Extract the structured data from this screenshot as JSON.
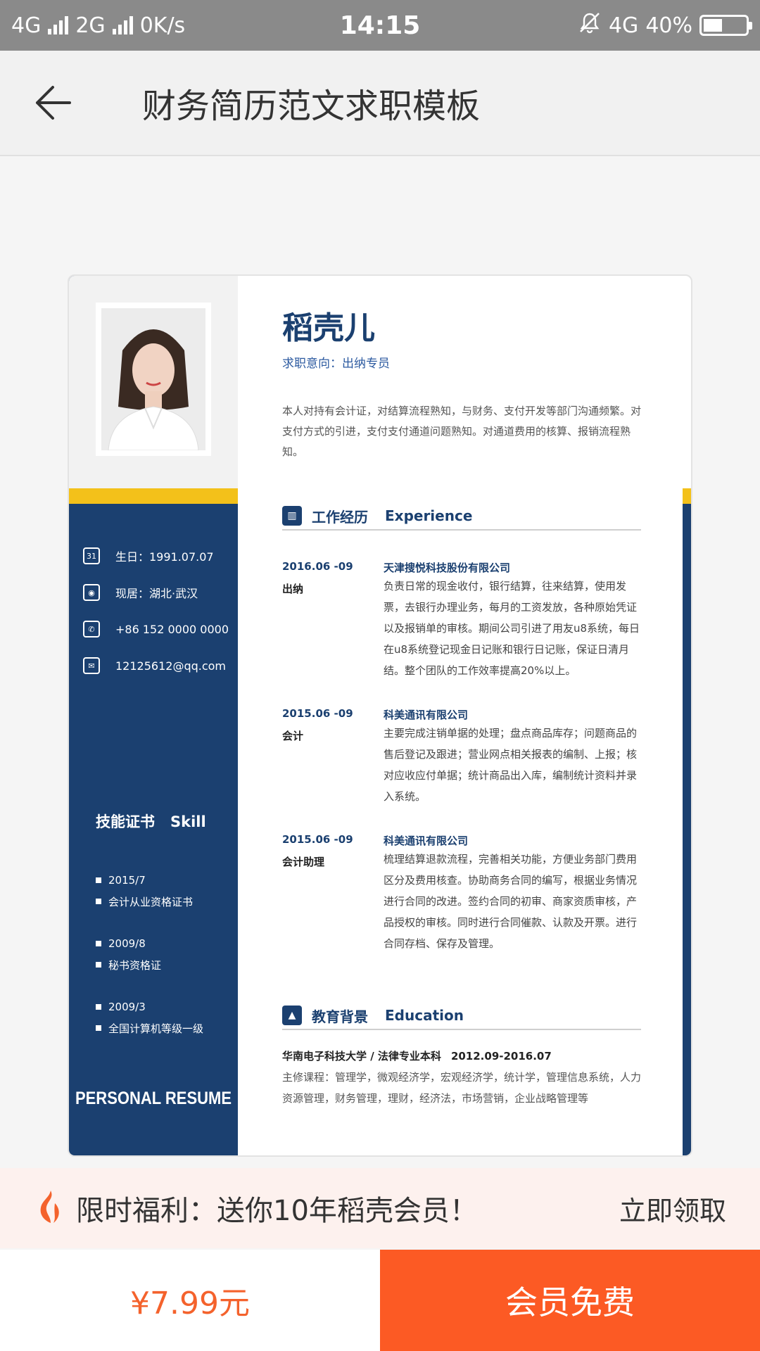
{
  "status_bar": {
    "net1": "4G",
    "net2": "2G",
    "speed": "0K/s",
    "time": "14:15",
    "net3": "4G",
    "battery": "40%"
  },
  "header": {
    "title": "财务简历范文求职模板"
  },
  "resume": {
    "name": "稻壳儿",
    "intent": "求职意向：出纳专员",
    "summary": "本人对持有会计证，对结算流程熟知，与财务、支付开发等部门沟通频繁。对支付方式的引进，支付支付通道问题熟知。对通道费用的核算、报销流程熟知。",
    "contact": [
      {
        "icon": "calendar-icon",
        "text": "生日：1991.07.07"
      },
      {
        "icon": "location-icon",
        "text": "现居：湖北·武汉"
      },
      {
        "icon": "phone-icon",
        "text": "+86 152 0000 0000"
      },
      {
        "icon": "mail-icon",
        "text": "12125612@qq.com"
      }
    ],
    "skill_title_cn": "技能证书",
    "skill_title_en": "Skill",
    "skills": [
      {
        "date": "2015/7",
        "name": "会计从业资格证书"
      },
      {
        "date": "2009/8",
        "name": "秘书资格证"
      },
      {
        "date": "2009/3",
        "name": "全国计算机等级一级"
      }
    ],
    "personal_resume": "PERSONAL RESUME",
    "experience_cn": "工作经历",
    "experience_en": "Experience",
    "jobs": [
      {
        "date": "2016.06 -09",
        "role": "出纳",
        "company": "天津搜悦科技股份有限公司",
        "desc": "负责日常的现金收付，银行结算，往来结算，使用发票，去银行办理业务，每月的工资发放，各种原始凭证以及报销单的审核。期间公司引进了用友u8系统，每日在u8系统登记现金日记账和银行日记账，保证日清月结。整个团队的工作效率提高20%以上。"
      },
      {
        "date": "2015.06 -09",
        "role": "会计",
        "company": "科美通讯有限公司",
        "desc": "主要完成注销单据的处理；盘点商品库存；问题商品的售后登记及跟进；营业网点相关报表的编制、上报；核对应收应付单据；统计商品出入库，编制统计资料并录入系统。"
      },
      {
        "date": "2015.06 -09",
        "role": "会计助理",
        "company": "科美通讯有限公司",
        "desc": "梳理结算退款流程，完善相关功能，方便业务部门费用区分及费用核查。协助商务合同的编写，根据业务情况进行合同的改进。签约合同的初审、商家资质审核，产品授权的审核。同时进行合同催款、认款及开票。进行合同存档、保存及管理。"
      }
    ],
    "education_cn": "教育背景",
    "education_en": "Education",
    "edu_school": "华南电子科技大学 / 法律专业本科",
    "edu_period": "2012.09-2016.07",
    "edu_courses": "主修课程：管理学，微观经济学，宏观经济学，统计学，管理信息系统，人力资源管理，财务管理，理财，经济法，市场营销，企业战略管理等"
  },
  "promo": {
    "text": "限时福利：送你10年稻壳会员！",
    "action": "立即领取"
  },
  "bottom": {
    "price": "¥7.99元",
    "member_button": "会员免费"
  },
  "colors": {
    "navy": "#1b4070",
    "yellow": "#f3c11a",
    "accent": "#fc5a24",
    "price": "#f4622c"
  }
}
